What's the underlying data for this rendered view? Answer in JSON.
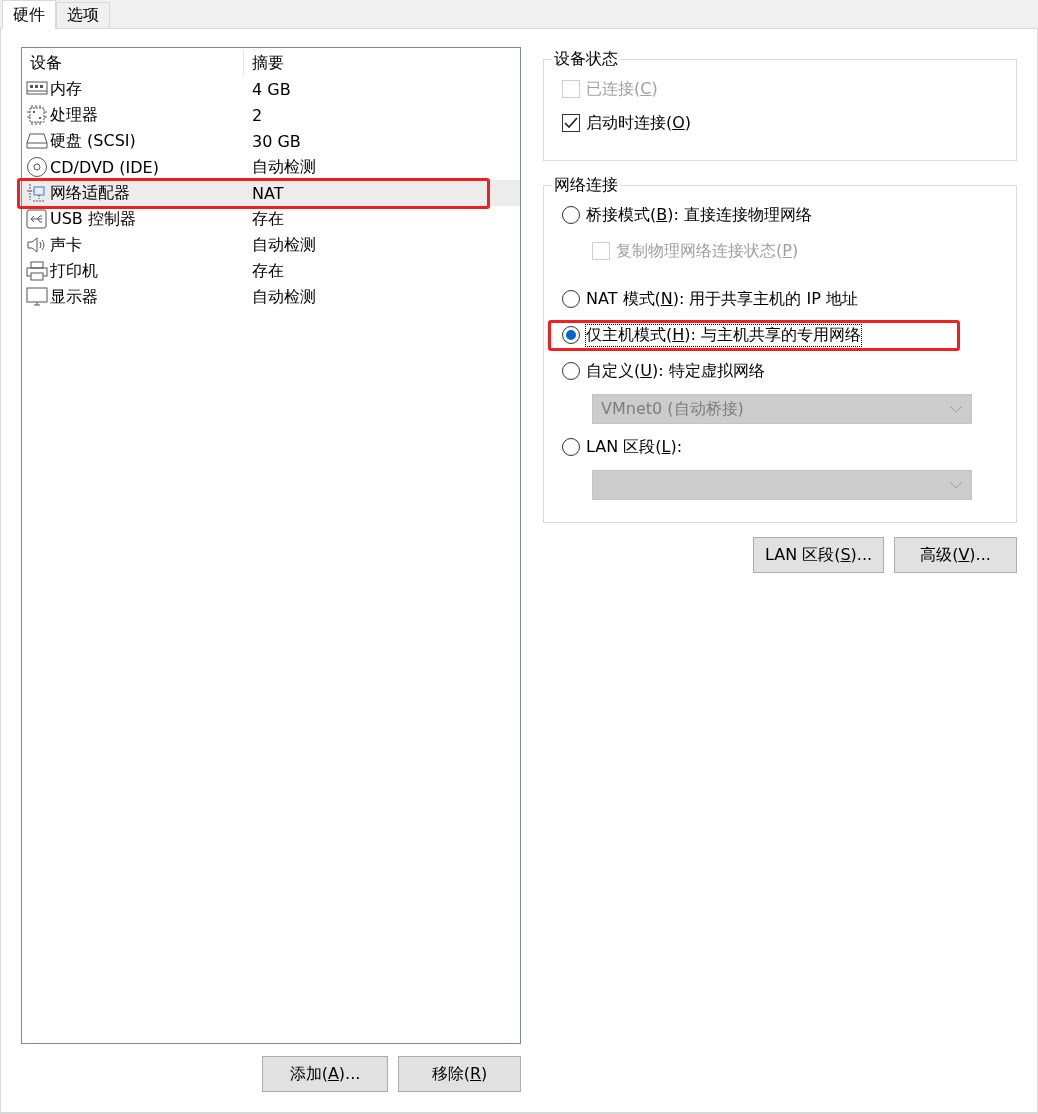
{
  "tabs": [
    {
      "label": "硬件",
      "selected": true
    },
    {
      "label": "选项",
      "selected": false
    }
  ],
  "device_list": {
    "columns": [
      "设备",
      "摘要"
    ],
    "rows": [
      {
        "kind": "memory",
        "name": "内存",
        "summary": "4 GB",
        "selected": false,
        "highlighted": false
      },
      {
        "kind": "cpu",
        "name": "处理器",
        "summary": "2",
        "selected": false,
        "highlighted": false
      },
      {
        "kind": "disk",
        "name": "硬盘 (SCSI)",
        "summary": "30 GB",
        "selected": false,
        "highlighted": false
      },
      {
        "kind": "cd",
        "name": "CD/DVD (IDE)",
        "summary": "自动检测",
        "selected": false,
        "highlighted": false
      },
      {
        "kind": "network",
        "name": "网络适配器",
        "summary": "NAT",
        "selected": true,
        "highlighted": true
      },
      {
        "kind": "usb",
        "name": "USB 控制器",
        "summary": "存在",
        "selected": false,
        "highlighted": false
      },
      {
        "kind": "sound",
        "name": "声卡",
        "summary": "自动检测",
        "selected": false,
        "highlighted": false
      },
      {
        "kind": "printer",
        "name": "打印机",
        "summary": "存在",
        "selected": false,
        "highlighted": false
      },
      {
        "kind": "display",
        "name": "显示器",
        "summary": "自动检测",
        "selected": false,
        "highlighted": false
      }
    ]
  },
  "list_buttons": [
    {
      "label": [
        "添加(",
        "A",
        ")..."
      ]
    },
    {
      "label": [
        "移除(",
        "R",
        ")"
      ]
    }
  ],
  "device_status": {
    "title": "设备状态",
    "checkboxes": [
      {
        "label": [
          "已连接(",
          "C",
          ")"
        ],
        "checked": false,
        "disabled": true
      },
      {
        "label": [
          "启动时连接(",
          "O",
          ")"
        ],
        "checked": true,
        "disabled": false
      }
    ]
  },
  "network_connection": {
    "title": "网络连接",
    "options": [
      {
        "kind": "radio",
        "label": [
          "桥接模式(",
          "B",
          "): 直接连接物理网络"
        ],
        "selected": false,
        "highlighted": false
      },
      {
        "kind": "checkbox",
        "label": [
          "复制物理网络连接状态(",
          "P",
          ")"
        ],
        "checked": false,
        "disabled": true
      },
      {
        "kind": "radio",
        "label": [
          "NAT 模式(",
          "N",
          "): 用于共享主机的 IP 地址"
        ],
        "selected": false,
        "highlighted": false
      },
      {
        "kind": "radio",
        "label": [
          "仅主机模式(",
          "H",
          "): 与主机共享的专用网络"
        ],
        "selected": true,
        "highlighted": true
      },
      {
        "kind": "radio",
        "label": [
          "自定义(",
          "U",
          "): 特定虚拟网络"
        ],
        "selected": false,
        "highlighted": false
      },
      {
        "kind": "dropdown",
        "value": "VMnet0 (自动桥接)",
        "disabled": true
      },
      {
        "kind": "radio",
        "label": [
          "LAN 区段(",
          "L",
          "):"
        ],
        "selected": false,
        "highlighted": false
      },
      {
        "kind": "dropdown",
        "disabled": true
      }
    ]
  },
  "network_buttons": [
    {
      "label": [
        "LAN 区段(",
        "S",
        ")..."
      ]
    },
    {
      "label": [
        "高级(",
        "V",
        ")..."
      ]
    }
  ]
}
